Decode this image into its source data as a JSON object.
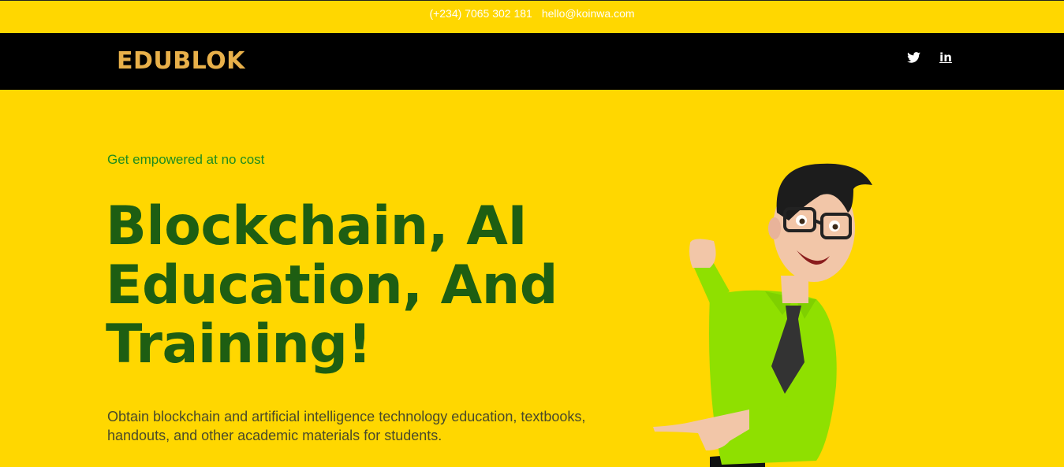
{
  "topbar": {
    "phone": "(+234) 7065 302 181",
    "email": "hello@koinwa.com"
  },
  "header": {
    "logo": "EDUBLOK",
    "social": [
      {
        "name": "twitter",
        "icon": "twitter-icon"
      },
      {
        "name": "linkedin",
        "icon": "linkedin-icon",
        "label": "in"
      }
    ]
  },
  "hero": {
    "tagline": "Get empowered at no cost",
    "title_line1": "Blockchain, AI",
    "title_line2": "Education, And",
    "title_line3": "Training!",
    "description": "Obtain blockchain and artificial intelligence technology education, textbooks, handouts, and other academic materials for students."
  },
  "colors": {
    "background": "#FFD700",
    "navbar": "#000000",
    "logo": "#E8B04A",
    "tagline": "#1F8C1F",
    "title": "#1E5E12"
  }
}
